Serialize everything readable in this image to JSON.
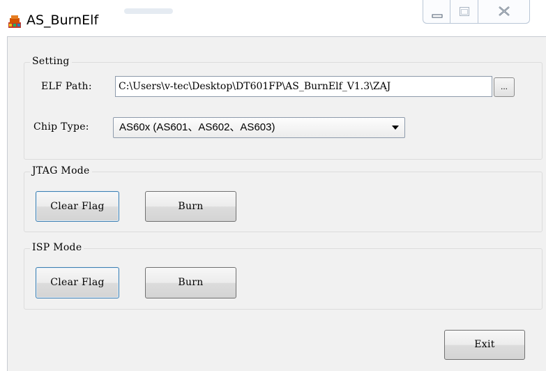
{
  "window": {
    "title": "AS_BurnElf"
  },
  "setting": {
    "group_title": "Setting",
    "elf_path_label": "ELF Path:",
    "elf_path_value": "C:\\Users\\v-tec\\Desktop\\DT601FP\\AS_BurnElf_V1.3\\ZAJ",
    "browse_label": "...",
    "chip_type_label": "Chip Type:",
    "chip_type_value": "AS60x (AS601、AS602、AS603)"
  },
  "jtag": {
    "group_title": "JTAG Mode",
    "clear_flag_label": "Clear Flag",
    "burn_label": "Burn"
  },
  "isp": {
    "group_title": "ISP Mode",
    "clear_flag_label": "Clear Flag",
    "burn_label": "Burn"
  },
  "footer": {
    "exit_label": "Exit"
  },
  "icons": {
    "app": "app-icon",
    "minimize": "minimize-icon",
    "maximize": "maximize-icon",
    "close": "close-icon",
    "dropdown": "chevron-down-icon"
  }
}
